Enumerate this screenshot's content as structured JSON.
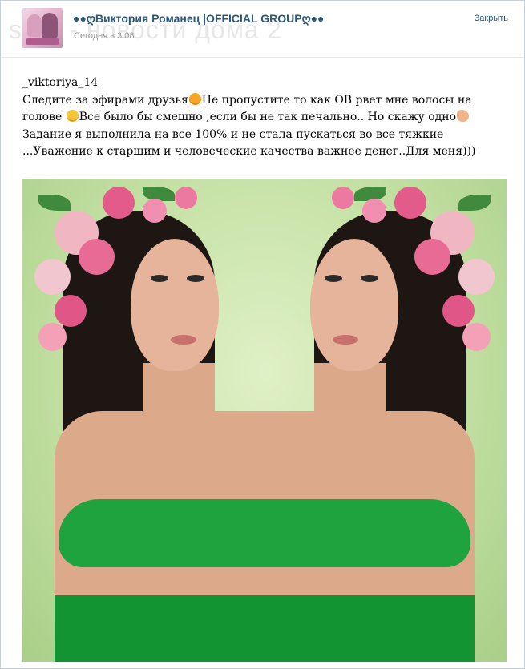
{
  "header": {
    "group_title": "●●ღВиктория Романец |OFFICIAL GROUPღ●●",
    "post_time": "Сегодня в 3:08",
    "close_label": "Закрыть",
    "watermark": "sp... - новости дома 2"
  },
  "post": {
    "lines": [
      "_viktoriya_14",
      "Следите за эфирами друзья",
      "Не пропустите то как ОВ рвет мне волосы на",
      "голове ",
      "Все было бы смешно ,если бы не так печально.. Но скажу одно",
      "Задание я выполнила на все 100% и не стала пускаться во все тяжкие",
      "...Уважение к старшим и человеческие качества важнее денег..Для меня)))"
    ],
    "emojis": [
      "heart-eyes-emoji",
      "grinning-emoji",
      "ok-hand-emoji"
    ]
  },
  "photo": {
    "description_icon": "mirrored-portrait-photo",
    "colors": {
      "background": "#c6e2a6",
      "swimsuit": "#1fa33e",
      "hair": "#1e1613"
    }
  }
}
